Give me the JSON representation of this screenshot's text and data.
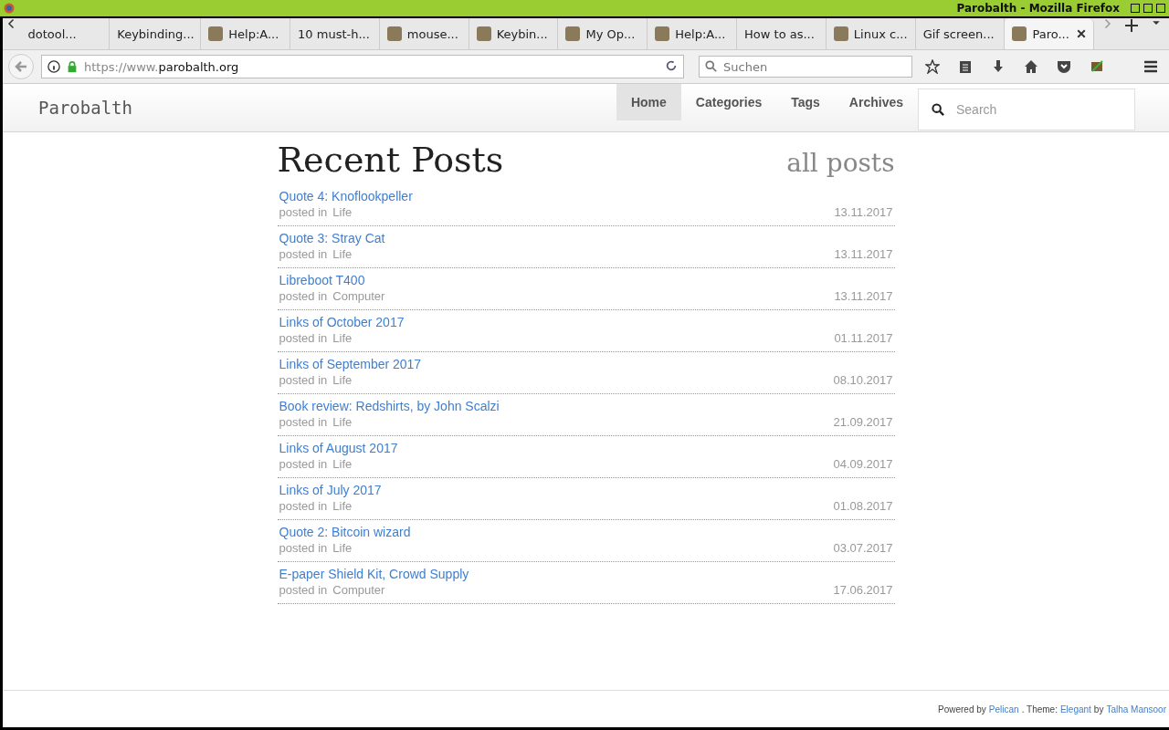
{
  "window": {
    "title": "Parobalth - Mozilla Firefox"
  },
  "tabs": [
    {
      "label": "dotool...",
      "kind": "plain",
      "selected": false
    },
    {
      "label": "Keybinding...",
      "kind": "plain",
      "selected": false
    },
    {
      "label": "Help:A...",
      "kind": "icon",
      "selected": false
    },
    {
      "label": "10 must-h...",
      "kind": "plain",
      "selected": false
    },
    {
      "label": "mouse...",
      "kind": "icon",
      "selected": false
    },
    {
      "label": "Keybin...",
      "kind": "icon",
      "selected": false
    },
    {
      "label": "My Op...",
      "kind": "icon",
      "selected": false
    },
    {
      "label": "Help:A...",
      "kind": "icon",
      "selected": false
    },
    {
      "label": "How to as...",
      "kind": "plain",
      "selected": false
    },
    {
      "label": "Linux c...",
      "kind": "icon",
      "selected": false
    },
    {
      "label": "Gif screen...",
      "kind": "plain",
      "selected": false
    },
    {
      "label": "Paro...",
      "kind": "icon",
      "selected": true
    }
  ],
  "url": {
    "prefix": "https://www.",
    "host": "parobalth.org"
  },
  "browser_search": {
    "placeholder": "Suchen"
  },
  "site": {
    "name": "Parobalth",
    "nav": [
      {
        "label": "Home",
        "selected": true
      },
      {
        "label": "Categories",
        "selected": false
      },
      {
        "label": "Tags",
        "selected": false
      },
      {
        "label": "Archives",
        "selected": false
      }
    ],
    "search": {
      "placeholder": "Search"
    }
  },
  "heading": "Recent Posts",
  "all_posts": "all posts",
  "posts": [
    {
      "title": "Quote 4: Knoflookpeller",
      "meta": "posted in",
      "category": "Life",
      "date": "13.11.2017"
    },
    {
      "title": "Quote 3: Stray Cat",
      "meta": "posted in",
      "category": "Life",
      "date": "13.11.2017"
    },
    {
      "title": "Libreboot T400",
      "meta": "posted in",
      "category": "Computer",
      "date": "13.11.2017"
    },
    {
      "title": "Links of October 2017",
      "meta": "posted in",
      "category": "Life",
      "date": "01.11.2017"
    },
    {
      "title": "Links of September 2017",
      "meta": "posted in",
      "category": "Life",
      "date": "08.10.2017"
    },
    {
      "title": "Book review: Redshirts, by John Scalzi",
      "meta": "posted in",
      "category": "Life",
      "date": "21.09.2017"
    },
    {
      "title": "Links of August 2017",
      "meta": "posted in",
      "category": "Life",
      "date": "04.09.2017"
    },
    {
      "title": "Links of July 2017",
      "meta": "posted in",
      "category": "Life",
      "date": "01.08.2017"
    },
    {
      "title": "Quote 2: Bitcoin wizard",
      "meta": "posted in",
      "category": "Life",
      "date": "03.07.2017"
    },
    {
      "title": "E-paper Shield Kit, Crowd Supply",
      "meta": "posted in",
      "category": "Computer",
      "date": "17.06.2017"
    }
  ],
  "footer": [
    {
      "text": "Powered by",
      "kind": "text"
    },
    {
      "text": "Pelican",
      "kind": "link"
    },
    {
      "text": ". Theme:",
      "kind": "text"
    },
    {
      "text": "Elegant",
      "kind": "link"
    },
    {
      "text": "by",
      "kind": "text"
    },
    {
      "text": "Talha Mansoor",
      "kind": "link"
    }
  ]
}
